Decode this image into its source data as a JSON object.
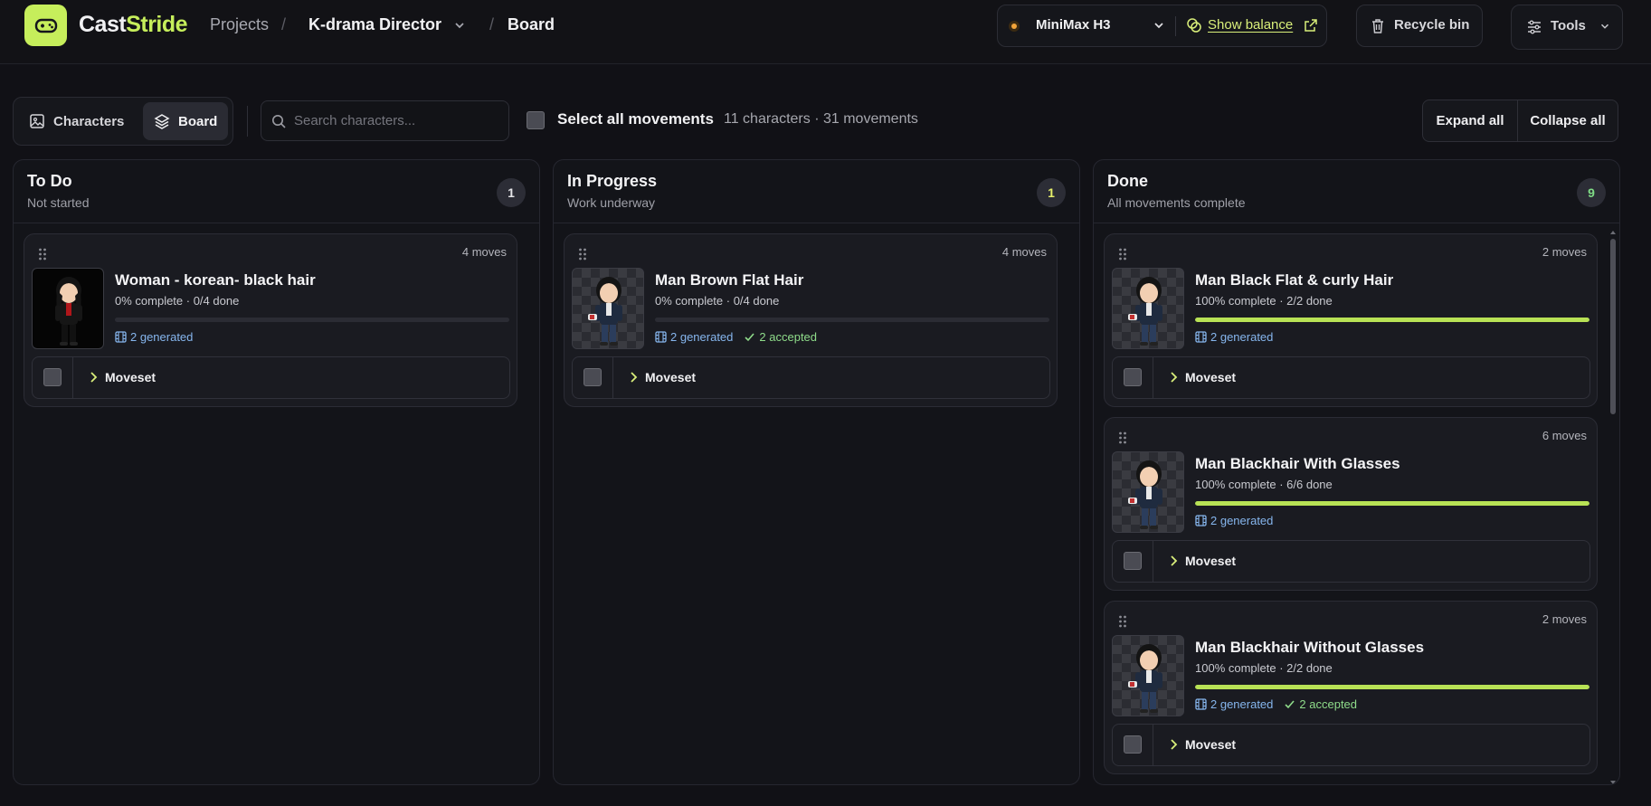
{
  "app": {
    "brand_first": "Cast",
    "brand_second": "Stride",
    "accent_color": "#c6ee5b"
  },
  "breadcrumb": {
    "projects": "Projects",
    "project": "K-drama Director",
    "page": "Board"
  },
  "header": {
    "model": "MiniMax H3",
    "show_balance": "Show balance",
    "recycle_bin": "Recycle bin",
    "tools": "Tools"
  },
  "toolbar": {
    "tab_characters": "Characters",
    "tab_board": "Board",
    "search_placeholder": "Search characters...",
    "select_all": "Select all movements",
    "summary": "11 characters · 31 movements",
    "expand_all": "Expand all",
    "collapse_all": "Collapse all"
  },
  "columns": [
    {
      "title": "To Do",
      "subtitle": "Not started",
      "count": "1",
      "count_color": "#e5e5e8",
      "cards": [
        {
          "name": "Woman - korean- black hair",
          "moves": "4 moves",
          "progress_text": "0% complete · 0/4 done",
          "progress": 0,
          "generated": "2 generated",
          "accepted": "",
          "moveset": "Moveset",
          "icon": "woman-character-thumbnail"
        }
      ]
    },
    {
      "title": "In Progress",
      "subtitle": "Work underway",
      "count": "1",
      "count_color": "#e6ef6a",
      "cards": [
        {
          "name": "Man Brown Flat Hair",
          "moves": "4 moves",
          "progress_text": "0% complete · 0/4 done",
          "progress": 0,
          "generated": "2 generated",
          "accepted": "2 accepted",
          "moveset": "Moveset",
          "icon": "man-character-thumbnail"
        }
      ]
    },
    {
      "title": "Done",
      "subtitle": "All movements complete",
      "count": "9",
      "count_color": "#7fdc86",
      "cards": [
        {
          "name": "Man Black Flat & curly Hair",
          "moves": "2 moves",
          "progress_text": "100% complete · 2/2 done",
          "progress": 100,
          "generated": "2 generated",
          "accepted": "",
          "moveset": "Moveset",
          "icon": "man-character-thumbnail"
        },
        {
          "name": "Man Blackhair With Glasses",
          "moves": "6 moves",
          "progress_text": "100% complete · 6/6 done",
          "progress": 100,
          "generated": "2 generated",
          "accepted": "",
          "moveset": "Moveset",
          "icon": "man-character-thumbnail"
        },
        {
          "name": "Man Blackhair Without Glasses",
          "moves": "2 moves",
          "progress_text": "100% complete · 2/2 done",
          "progress": 100,
          "generated": "2 generated",
          "accepted": "2 accepted",
          "moveset": "Moveset",
          "icon": "man-character-thumbnail"
        }
      ]
    }
  ]
}
